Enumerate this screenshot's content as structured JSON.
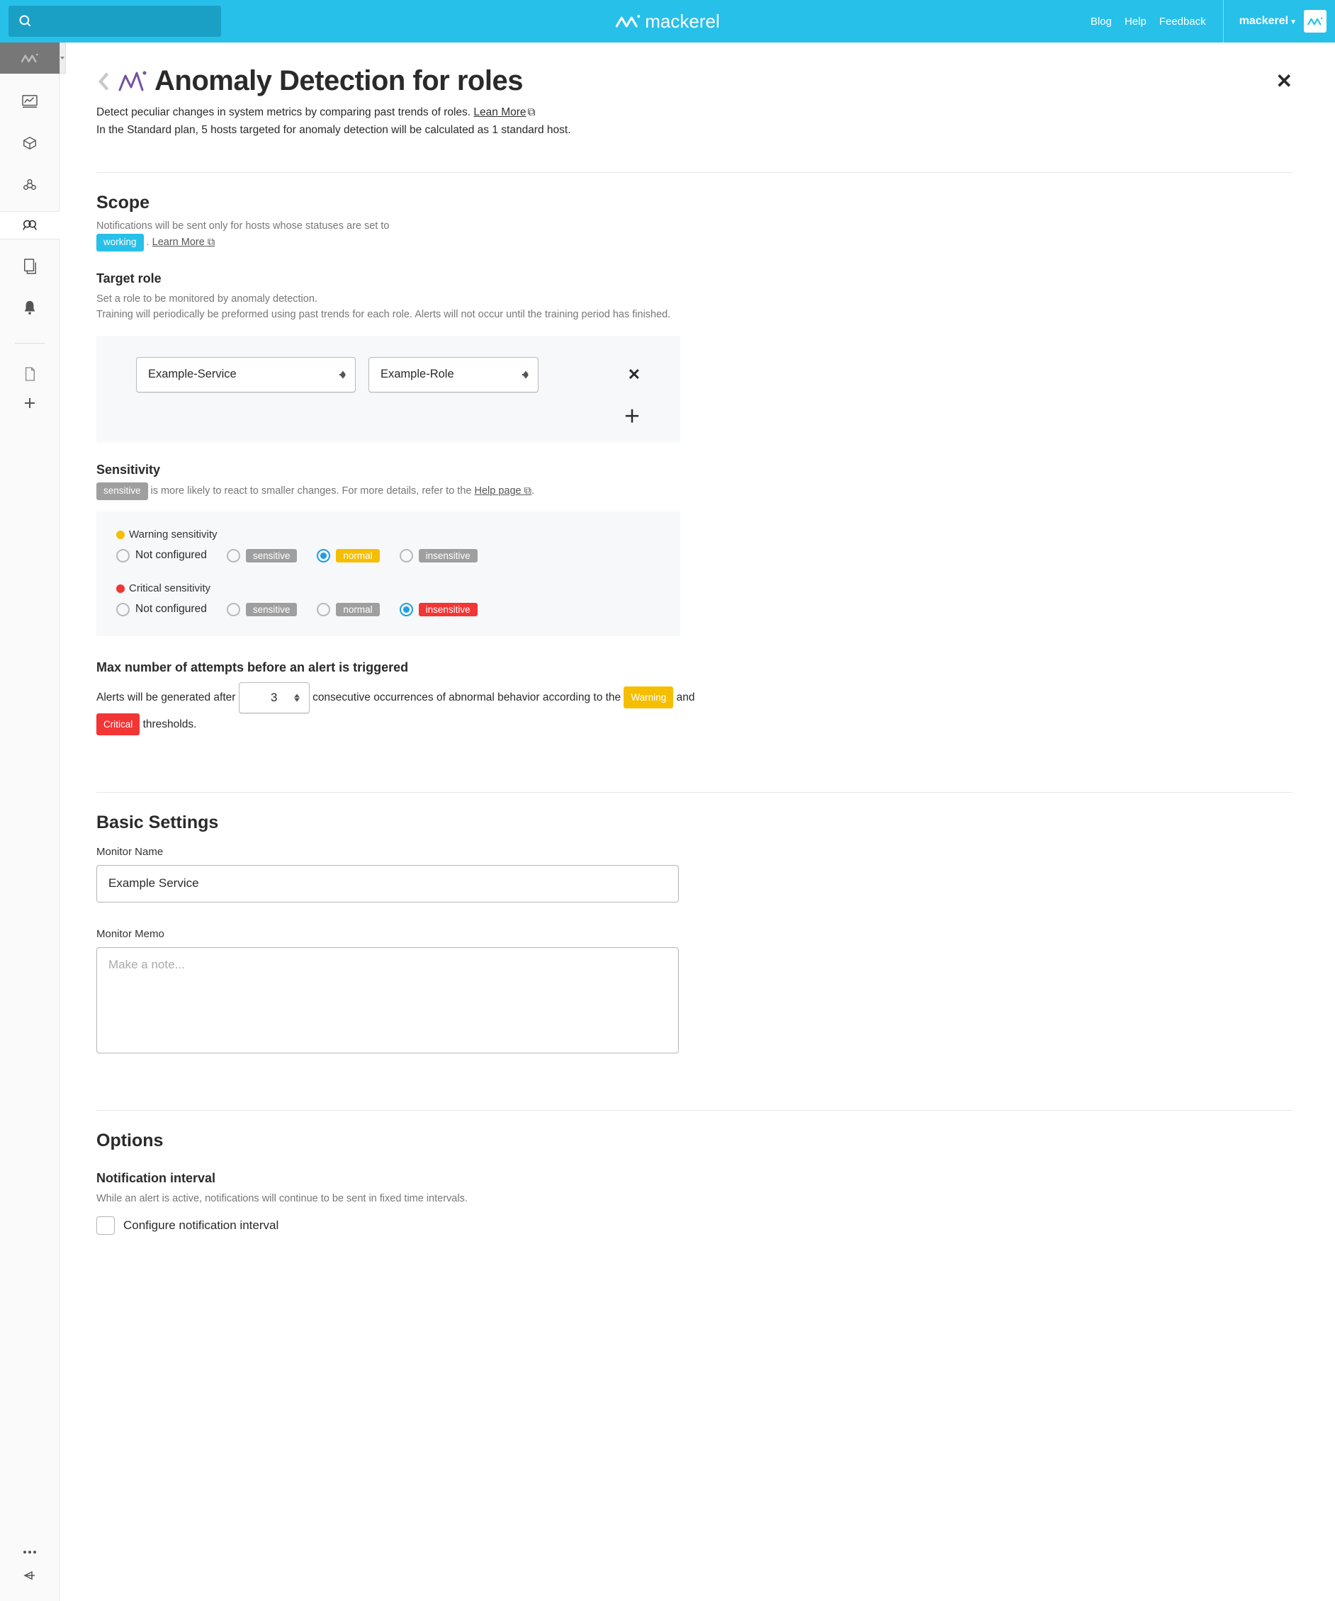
{
  "topbar": {
    "brand": "mackerel",
    "links": {
      "blog": "Blog",
      "help": "Help",
      "feedback": "Feedback"
    },
    "org": "mackerel"
  },
  "page": {
    "title": "Anomaly Detection for roles",
    "intro_a": "Detect peculiar changes in system metrics by comparing past trends of roles. ",
    "learn_more": "Lean More",
    "intro_b": "In the Standard plan, 5 hosts targeted for anomaly detection will be calculated as 1 standard host."
  },
  "scope": {
    "heading": "Scope",
    "note_a": "Notifications will be sent only for hosts whose statuses are set to",
    "status_badge": "working",
    "learn_more": "Learn More"
  },
  "target": {
    "heading": "Target role",
    "note_a": "Set a role to be monitored by anomaly detection.",
    "note_b": "Training will periodically be preformed using past trends for each role. Alerts will not occur until the training period has finished.",
    "service": "Example-Service",
    "role": "Example-Role"
  },
  "sensitivity": {
    "heading": "Sensitivity",
    "sensitive_badge": "sensitive",
    "note_a": " is more likely to react to smaller changes. For more details, refer to the ",
    "help_link": "Help page",
    "warning_label": "Warning sensitivity",
    "critical_label": "Critical sensitivity",
    "opts": {
      "none": "Not configured",
      "sensitive": "sensitive",
      "normal": "normal",
      "insensitive": "insensitive"
    }
  },
  "attempts": {
    "heading": "Max number of attempts before an alert is triggered",
    "text_a": "Alerts will be generated after ",
    "value": "3",
    "text_b": " consecutive occurrences of abnormal behavior according to the ",
    "warning_badge": "Warning",
    "and": " and ",
    "critical_badge": "Critical",
    "text_c": " thresholds."
  },
  "basic": {
    "heading": "Basic Settings",
    "name_label": "Monitor Name",
    "name_value": "Example Service",
    "memo_label": "Monitor Memo",
    "memo_placeholder": "Make a note..."
  },
  "options": {
    "heading": "Options",
    "notif_heading": "Notification interval",
    "notif_note": "While an alert is active, notifications will continue to be sent in fixed time intervals.",
    "chk_label": "Configure notification interval"
  }
}
